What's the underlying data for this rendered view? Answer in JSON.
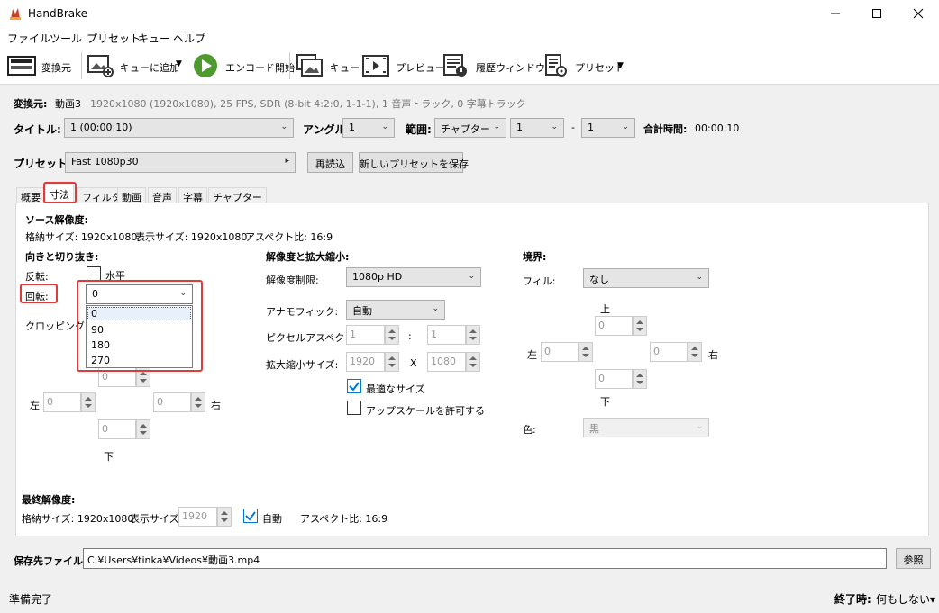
{
  "window": {
    "title": "HandBrake"
  },
  "menu": [
    "ファイル",
    "ツール",
    "プリセット",
    "キュー",
    "ヘルプ"
  ],
  "toolbar": {
    "source": "変換元",
    "add_queue": "キューに追加",
    "encode": "エンコード開始",
    "queue": "キュー",
    "preview": "プレビュー",
    "activity": "履歴ウィンドウ",
    "presets": "プリセット"
  },
  "source_info": {
    "label": "変換元:",
    "name": "動画3",
    "details": "1920x1080 (1920x1080), 25 FPS, SDR (8-bit 4:2:0, 1-1-1), 1 音声トラック, 0 字幕トラック"
  },
  "title_row": {
    "title_label": "タイトル:",
    "title_value": "1 (00:00:10)",
    "angle_label": "アングル:",
    "angle_value": "1",
    "range_label": "範囲:",
    "range_type": "チャプター",
    "range_start": "1",
    "range_dash": "-",
    "range_end": "1",
    "duration_label": "合計時間:",
    "duration_value": "00:00:10"
  },
  "preset_row": {
    "label": "プリセット:",
    "value": "Fast 1080p30",
    "reload": "再読込",
    "save_new": "新しいプリセットを保存"
  },
  "tabs": [
    "概要",
    "寸法",
    "フィルタ",
    "動画",
    "音声",
    "字幕",
    "チャプター"
  ],
  "dimensions": {
    "source_heading": "ソース解像度:",
    "storage_size": "格納サイズ: 1920x1080",
    "display_size": "表示サイズ: 1920x1080",
    "aspect": "アスペクト比: 16:9",
    "orientation_heading": "向きと切り抜き:",
    "flip_label": "反転:",
    "flip_option": "水平",
    "rotate_label": "回転:",
    "rotate_value": "0",
    "rotate_options": [
      "0",
      "90",
      "180",
      "270"
    ],
    "cropping_label": "クロッピング:",
    "crop": {
      "top": "0",
      "bottom": "0",
      "left": "0",
      "right": "0",
      "left_label": "左",
      "right_label": "右",
      "bottom_label": "下"
    },
    "resolution_heading": "解像度と拡大縮小:",
    "res_limit_label": "解像度制限:",
    "res_limit_value": "1080p HD",
    "anamorphic_label": "アナモフィック:",
    "anamorphic_value": "自動",
    "par_label": "ピクセルアスペクト比:",
    "par_x": "1",
    "par_colon": ":",
    "par_y": "1",
    "scale_label": "拡大縮小サイズ:",
    "scale_w": "1920",
    "scale_x": "X",
    "scale_h": "1080",
    "optimal_size": "最適なサイズ",
    "allow_upscale": "アップスケールを許可する",
    "border_heading": "境界:",
    "fill_label": "フィル:",
    "fill_value": "なし",
    "border": {
      "top_label": "上",
      "top": "0",
      "left_label": "左",
      "left": "0",
      "right": "0",
      "right_label": "右",
      "bottom": "0",
      "bottom_label": "下"
    },
    "color_label": "色:",
    "color_value": "黒",
    "final_heading": "最終解像度:",
    "final_storage": "格納サイズ: 1920x1080",
    "final_display_label": "表示サイズ:",
    "final_display_value": "1920",
    "final_auto": "自動",
    "final_aspect": "アスペクト比: 16:9"
  },
  "destination": {
    "label": "保存先ファイル:",
    "path": "C:¥Users¥tinka¥Videos¥動画3.mp4",
    "browse": "参照"
  },
  "status": {
    "text": "準備完了",
    "when_done_label": "終了時:",
    "when_done_value": "何もしない▾"
  },
  "colors": {
    "highlight": "#e03a3a",
    "selection": "#0078d7",
    "check": "#0078d7"
  }
}
